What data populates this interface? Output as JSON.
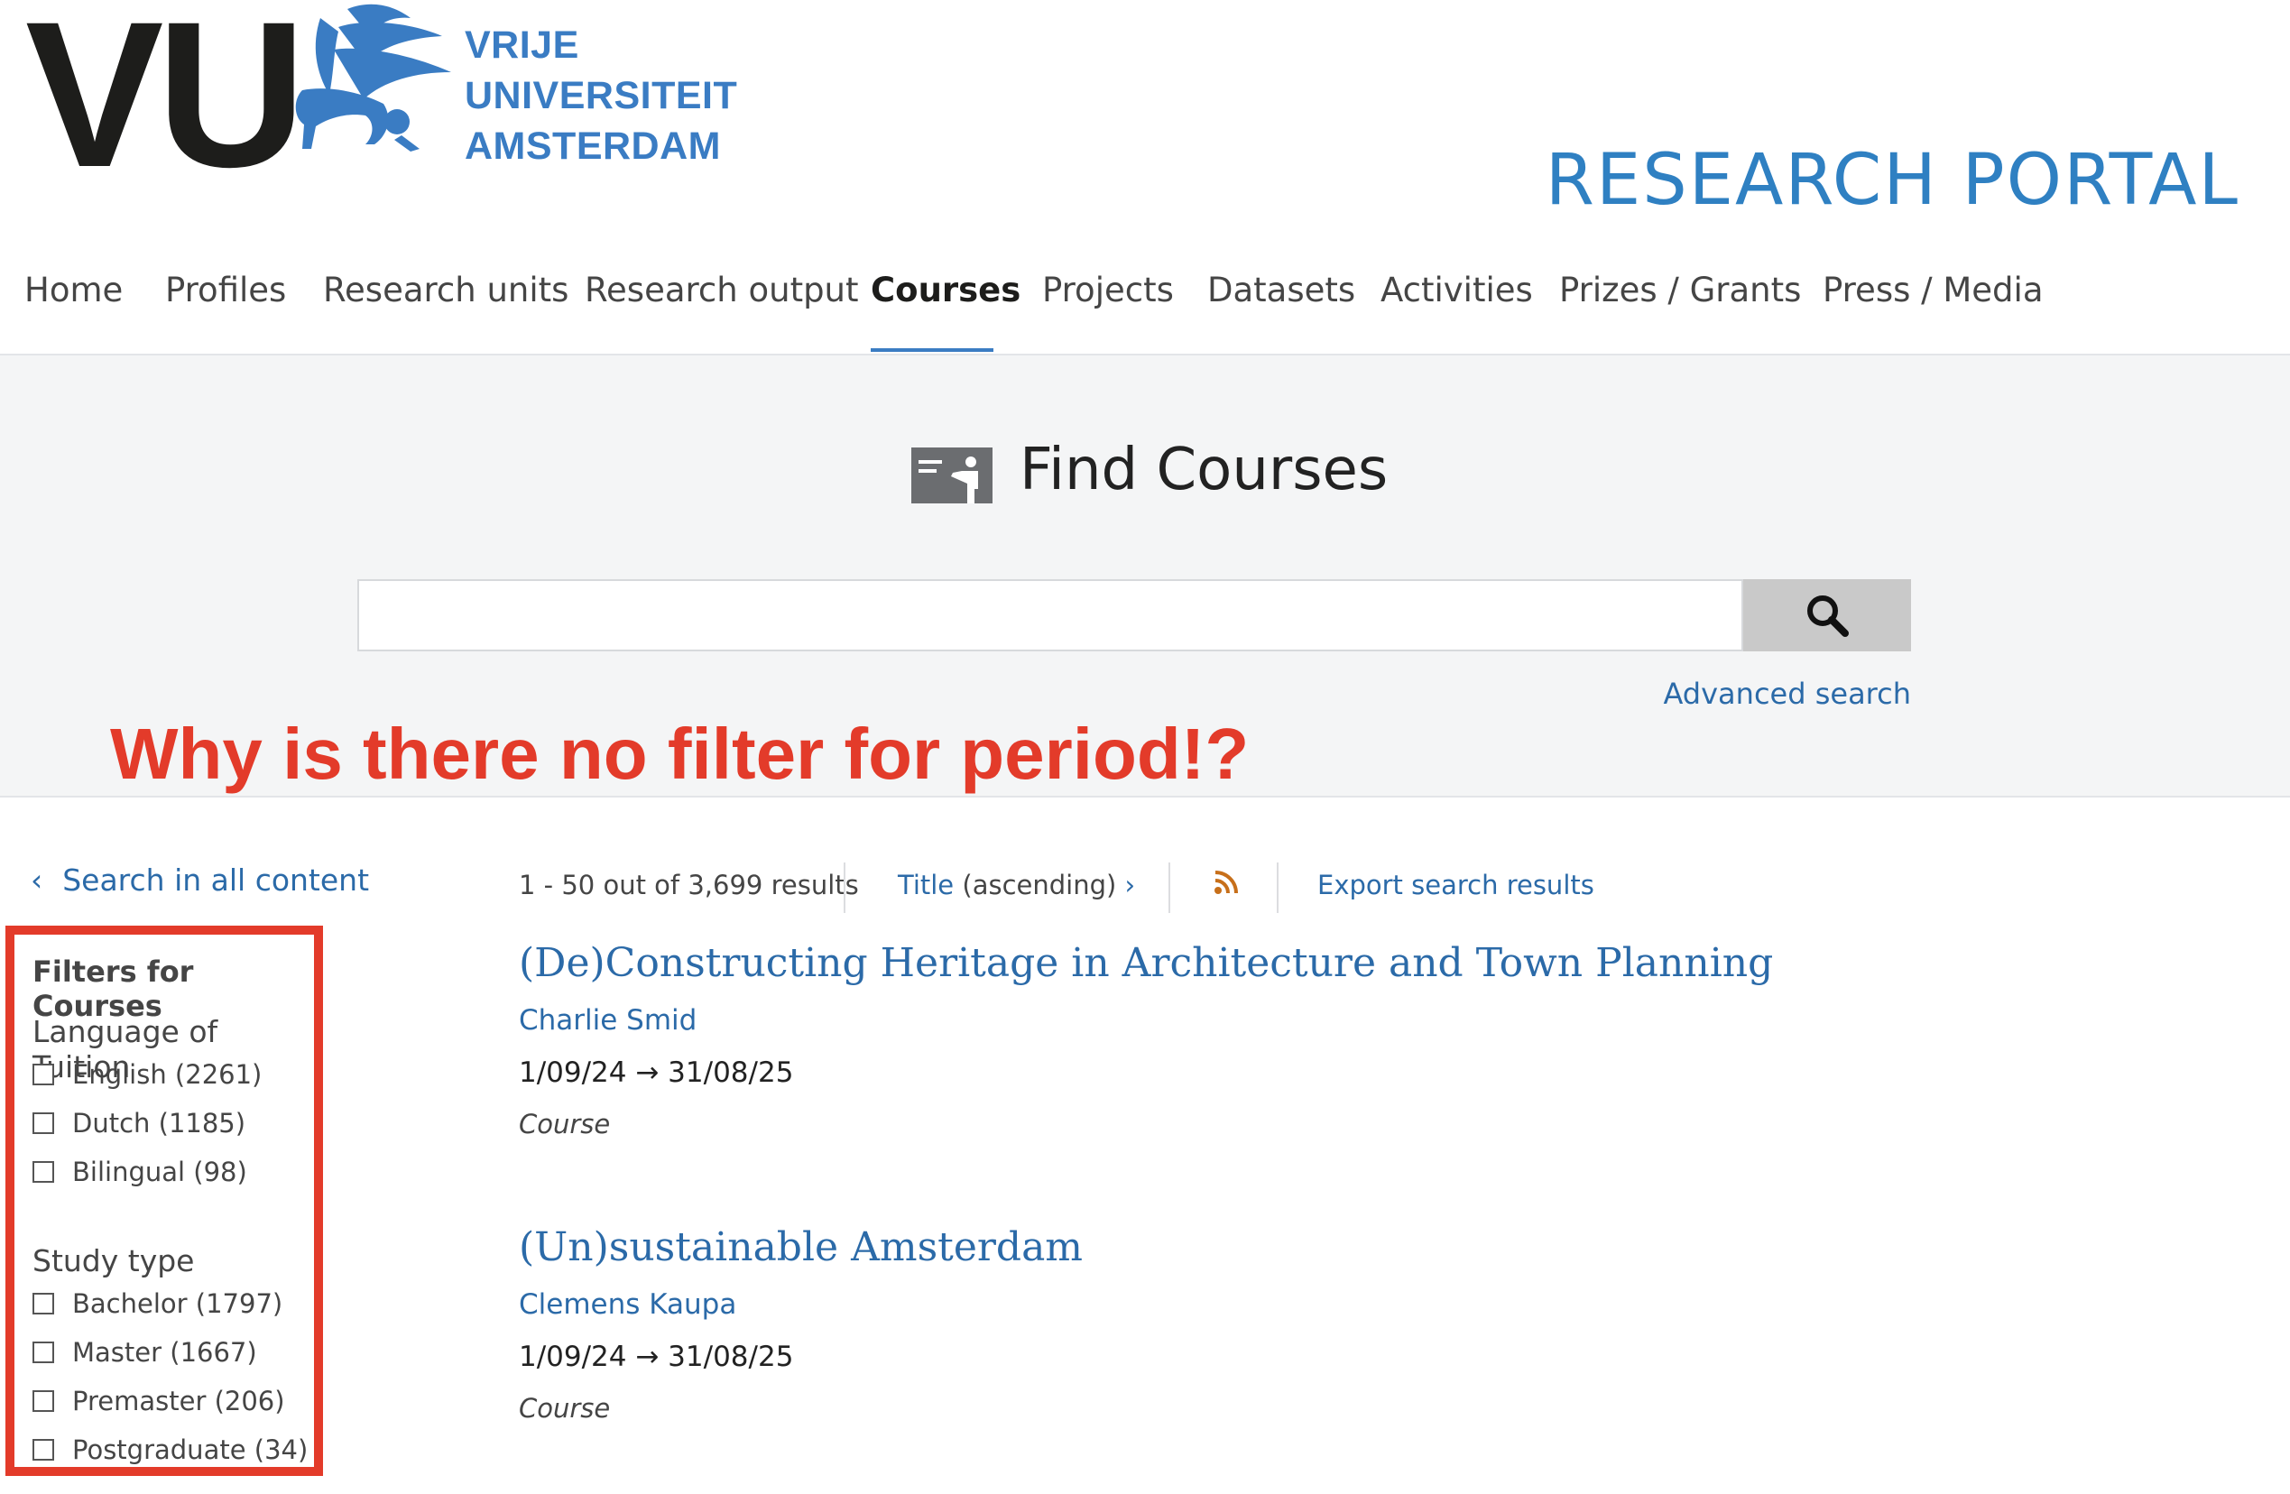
{
  "header": {
    "logo_letters": "VU",
    "logo_line1": "VRIJE",
    "logo_line2": "UNIVERSITEIT",
    "logo_line3": "AMSTERDAM",
    "portal_title": "RESEARCH PORTAL",
    "brand_color": "#3a7cc3"
  },
  "nav": {
    "items": [
      {
        "label": "Home"
      },
      {
        "label": "Profiles"
      },
      {
        "label": "Research units"
      },
      {
        "label": "Research output"
      },
      {
        "label": "Courses",
        "active": true
      },
      {
        "label": "Projects"
      },
      {
        "label": "Datasets"
      },
      {
        "label": "Activities"
      },
      {
        "label": "Prizes / Grants"
      },
      {
        "label": "Press / Media"
      }
    ]
  },
  "find": {
    "icon": "course-presentation-icon",
    "title": "Find Courses",
    "search_value": "",
    "search_button_icon": "search-icon",
    "advanced_search": "Advanced search"
  },
  "annotation": {
    "text": "Why is there no filter for period!?",
    "color": "#e33b2a"
  },
  "sidebar": {
    "back_link": "Search in all content",
    "filters_title": "Filters for Courses",
    "groups": [
      {
        "title": "Language of Tuition",
        "options": [
          {
            "label": "English (2261)",
            "checked": false
          },
          {
            "label": "Dutch (1185)",
            "checked": false
          },
          {
            "label": "Bilingual (98)",
            "checked": false
          }
        ]
      },
      {
        "title": "Study type",
        "options": [
          {
            "label": "Bachelor (1797)",
            "checked": false
          },
          {
            "label": "Master (1667)",
            "checked": false
          },
          {
            "label": "Premaster (206)",
            "checked": false
          },
          {
            "label": "Postgraduate (34)",
            "checked": false
          }
        ]
      }
    ]
  },
  "results_bar": {
    "count": "1 - 50 out of 3,699 results",
    "sort_field": "Title",
    "sort_order": "(ascending)",
    "rss_icon": "rss-icon",
    "export": "Export search results"
  },
  "results": [
    {
      "title": "(De)Constructing Heritage in Architecture and Town Planning",
      "person": "Charlie Smid",
      "date": "1/09/24 → 31/08/25",
      "type": "Course"
    },
    {
      "title": "(Un)sustainable Amsterdam",
      "person": "Clemens Kaupa",
      "date": "1/09/24 → 31/08/25",
      "type": "Course"
    }
  ]
}
